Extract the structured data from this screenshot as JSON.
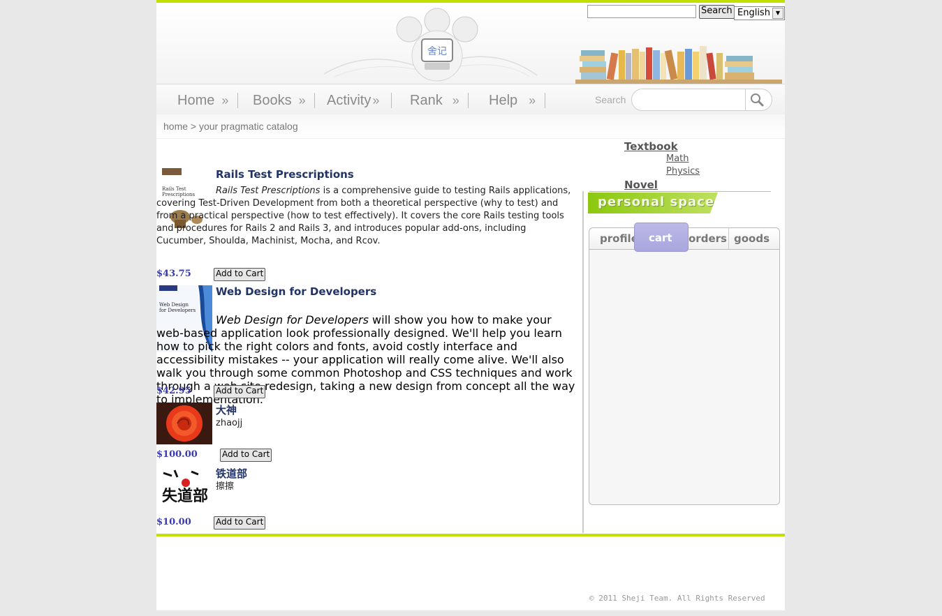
{
  "header": {
    "search_button": "Search",
    "language": "English",
    "logo_text": "舍记"
  },
  "nav": {
    "items": [
      "Home",
      "Books",
      "Activity",
      "Rank",
      "Help"
    ],
    "raquo": "»",
    "search_label": "Search"
  },
  "breadcrumb": "home > your pragmatic catalog",
  "products": [
    {
      "title": "Rails Test Prescriptions",
      "desc_em": "Rails Test Prescriptions",
      "desc_rest": " is a comprehensive guide to testing Rails applications, covering Test-Driven Development from both a theoretical perspective (why to test) and from a practical perspective (how to test effectively). It covers the core Rails testing tools and procedures for Rails 2 and Rails 3, and introduces popular add-ons, including Cucumber, Shoulda, Machinist, Mocha, and Rcov.",
      "price": "$43.75",
      "cart_label": "Add to Cart"
    },
    {
      "title": "Web Design for Developers",
      "desc_em": "Web Design for Developers",
      "desc_rest": " will show you how to make your web-based application look professionally designed. We'll help you learn how to pick the right colors and fonts, avoid costly interface and accessibility mistakes -- your application will really come alive. We'll also walk you through some common Photoshop and CSS techniques and work through a web site redesign, taking a new design from concept all the way to implementation.",
      "price": "$42.95",
      "cart_label": "Add to Cart"
    },
    {
      "title": "大神",
      "desc": "zhaojj",
      "price": "$100.00",
      "cart_label": "Add to Cart"
    },
    {
      "title": "铁道部",
      "desc": "擦擦",
      "price": "$10.00",
      "cart_label": "Add to Cart"
    }
  ],
  "categories": {
    "textbook": "Textbook",
    "math": "Math",
    "physics": "Physics",
    "novel": "Novel"
  },
  "personal_space": {
    "title": "personal space",
    "tabs": [
      "profile",
      "cart",
      "orders",
      "goods"
    ],
    "active_tab": "cart"
  },
  "footer": {
    "copyright": "© 2011 Sheji Team. All Rights Reserved"
  },
  "colors": {
    "accent_green": "#c3df00",
    "title_blue": "#223366",
    "price_blue": "#3a3ab0",
    "tab_active": "#a9a6de"
  }
}
